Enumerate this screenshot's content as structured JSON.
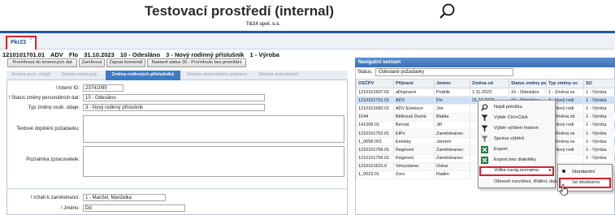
{
  "header": {
    "title": "Testovací prostředí (internal)",
    "company": "T&14 spol. s.s."
  },
  "tabs": [
    {
      "label": "Pkr23",
      "close": "×"
    }
  ],
  "record": {
    "parts": [
      "1210101701.01",
      "ADV",
      "Flo",
      "31.10.2023",
      "10 - Odesláno",
      "3 - Nový rodinný příslušník",
      "1 - Výroba"
    ]
  },
  "toolbar": {
    "buttons": [
      "Promítnout do kmenových dat",
      "Zamítnout",
      "Zapsat komentář",
      "Nastavit status 30 - Promítnuto bez promítání"
    ]
  },
  "subtabs": [
    "Změna pers. údajů",
    "Změna zdrav.poj.",
    "Změna rodinných příslušníků",
    "Změna občanského průkazu",
    "Změna dokumentů"
  ],
  "form": {
    "interni_id_label": "! Interní ID:",
    "interni_id_value": "23741095",
    "status_label": "! Status změny personálních dat:",
    "status_value": "10 - Odesláno",
    "typ_label": "Typ změny osob. údaje:",
    "typ_value": "3 - Nový rodinný příslušník",
    "text_label": "Textové doplnění požadavku:",
    "poznamka_label": "Poznámka zpracovatele:",
    "vztah_label": "! Vztah k zaměstnanci:",
    "vztah_value": "1 - Manžel, Manželka",
    "jmeno_label": "! Jméno:",
    "jmeno_value": "Dd"
  },
  "nav": {
    "title": "Navigační seznam",
    "status_label": "Status:",
    "status_value": "Odeslané požadavky",
    "columns": [
      "OSČPV",
      "Příjmení",
      "Jméno",
      "Změna od",
      "Status změny per",
      "Typ změny os",
      "SO"
    ],
    "rows": [
      [
        "1210101607.01",
        "aDopravní",
        "Podnik",
        "1.11.2023",
        "10 - Odesláno",
        "1 - Změna os",
        "1 - Výroba"
      ],
      [
        "1210101701.01",
        "ADV",
        "Flo",
        "31.10.2023",
        "10 - Odesláno",
        "3 - Nový rodi",
        "1 - Výroba"
      ],
      [
        "1210101680.01",
        "ADV Exekuce",
        "Joe",
        "",
        "",
        "3 - Nový rodi",
        "1 - Výroba"
      ],
      [
        "1544",
        "Bělinová Druhá",
        "Blabla",
        "",
        "",
        "3 - Změna zd",
        "1 - Výroba"
      ],
      [
        "141568.01",
        "Bernát",
        "Jiří",
        "",
        "",
        "3 - Nový rodi",
        "1 - Výroba"
      ],
      [
        "1210101752.01",
        "ElPo",
        "Zaměstnanec",
        "",
        "",
        "1 - Změna os",
        "1 - Výroba"
      ],
      [
        "1_0058.001",
        "Emilsky",
        "Jaromír",
        "",
        "",
        "1 - Změna os",
        "1 - Výroba"
      ],
      [
        "1210101766.01",
        "Regresní",
        "Zaměstnanec",
        "",
        "",
        "3 - Nový rodi",
        "1 - Výroba"
      ],
      [
        "1210101766.01",
        "Regresní",
        "Zaměstnanec",
        "",
        "",
        "",
        "1 - Výroba"
      ],
      [
        "1210101631.0",
        "Velvyslanec",
        "Oskar",
        "",
        "",
        "",
        "1 - Výroba"
      ],
      [
        "1_0023.01",
        "Zoro",
        "Radim",
        "",
        "",
        "",
        "1 - Výroba"
      ]
    ]
  },
  "context_menu": {
    "items": [
      "Najdi položku",
      "Výběr Ctrl+Click",
      "Výběr výčtem hodnot",
      "Správa výběrů",
      "Export",
      "Export bez diakritiky",
      "Volba navig.seznamu",
      "Obnovit rozvržení, třídění, data"
    ],
    "icons": [
      "search-icon",
      "filter-icon",
      "filter-list-icon",
      "filter-manage-icon",
      "excel-icon",
      "excel-icon",
      "",
      ""
    ],
    "submenu_arrow": "▸",
    "submenu": [
      "Standardní",
      "Se strukturou"
    ],
    "accent": "#d8202a"
  }
}
